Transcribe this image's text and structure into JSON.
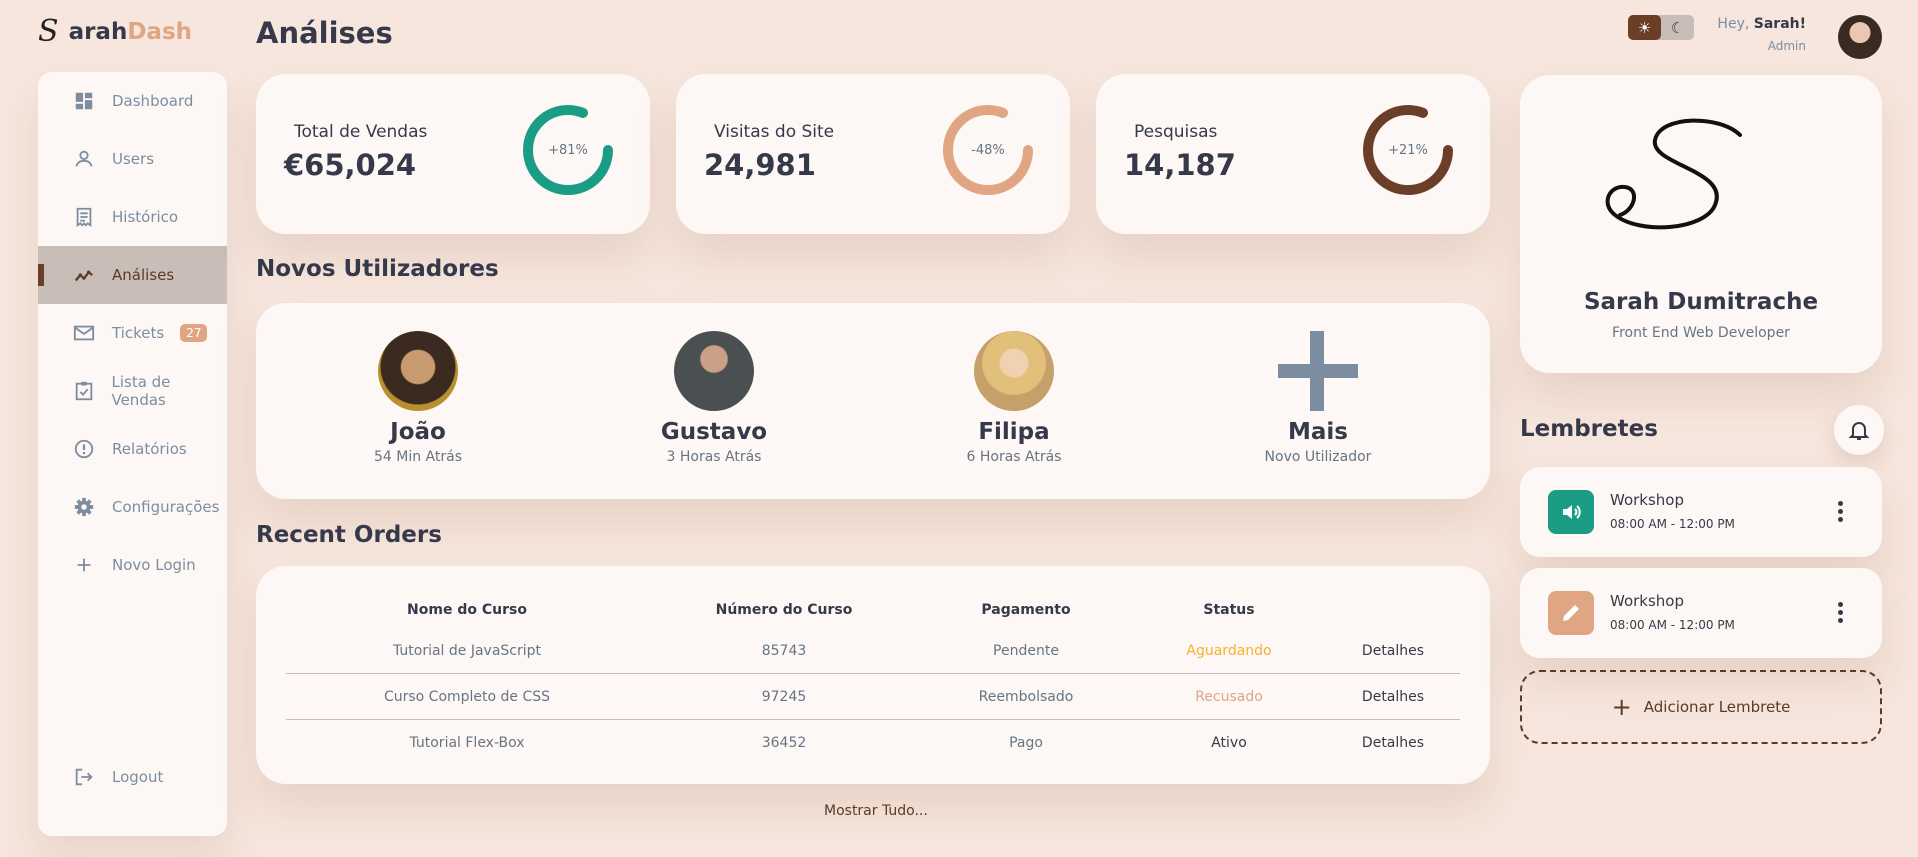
{
  "logo": {
    "mark": "S",
    "name_part1": "arah",
    "name_part2": "Dash"
  },
  "sidebar": {
    "items": [
      {
        "label": "Dashboard",
        "icon": "dashboard-icon"
      },
      {
        "label": "Users",
        "icon": "user-icon"
      },
      {
        "label": "Histórico",
        "icon": "receipt-icon"
      },
      {
        "label": "Análises",
        "icon": "insights-icon",
        "active": true
      },
      {
        "label": "Tickets",
        "icon": "mail-icon",
        "badge": "27"
      },
      {
        "label": "Lista de Vendas",
        "icon": "inventory-icon"
      },
      {
        "label": "Relatórios",
        "icon": "report-icon"
      },
      {
        "label": "Configurações",
        "icon": "settings-icon"
      },
      {
        "label": "Novo Login",
        "icon": "add-icon"
      }
    ],
    "logout": "Logout"
  },
  "header": {
    "title": "Análises",
    "greeting_prefix": "Hey,",
    "user_name": "Sarah!",
    "role": "Admin",
    "theme": {
      "light_icon": "sun-icon",
      "dark_icon": "moon-icon",
      "active": "light"
    }
  },
  "stats": [
    {
      "label": "Total de Vendas",
      "value": "€65,024",
      "percent": "+81%",
      "fill": 0.81,
      "color": "#1b9c85"
    },
    {
      "label": "Visitas do Site",
      "value": "24,981",
      "percent": "-48%",
      "fill": 0.81,
      "color": "#e0a582"
    },
    {
      "label": "Pesquisas",
      "value": "14,187",
      "percent": "+21%",
      "fill": 0.81,
      "color": "#6b3f27"
    }
  ],
  "new_users": {
    "title": "Novos Utilizadores",
    "users": [
      {
        "name": "João",
        "time": "54 Min Atrás"
      },
      {
        "name": "Gustavo",
        "time": "3 Horas Atrás"
      },
      {
        "name": "Filipa",
        "time": "6 Horas Atrás"
      }
    ],
    "more": {
      "name": "Mais",
      "subtitle": "Novo Utilizador"
    }
  },
  "orders": {
    "title": "Recent Orders",
    "columns": [
      "Nome do Curso",
      "Número do Curso",
      "Pagamento",
      "Status",
      ""
    ],
    "rows": [
      {
        "course": "Tutorial de JavaScript",
        "number": "85743",
        "payment": "Pendente",
        "status": "Aguardando",
        "action": "Detalhes"
      },
      {
        "course": "Curso Completo de CSS",
        "number": "97245",
        "payment": "Reembolsado",
        "status": "Recusado",
        "action": "Detalhes"
      },
      {
        "course": "Tutorial Flex-Box",
        "number": "36452",
        "payment": "Pago",
        "status": "Ativo",
        "action": "Detalhes"
      }
    ],
    "show_all": "Mostrar Tudo..."
  },
  "profile": {
    "signature": "S",
    "name": "Sarah Dumitrache",
    "role": "Front End Web Developer"
  },
  "reminders": {
    "title": "Lembretes",
    "items": [
      {
        "title": "Workshop",
        "time": "08:00 AM - 12:00 PM",
        "icon": "volume-icon",
        "color": "#1b9c85"
      },
      {
        "title": "Workshop",
        "time": "08:00 AM - 12:00 PM",
        "icon": "edit-icon",
        "color": "#e0a582"
      }
    ],
    "add_label": "Adicionar Lembrete"
  }
}
